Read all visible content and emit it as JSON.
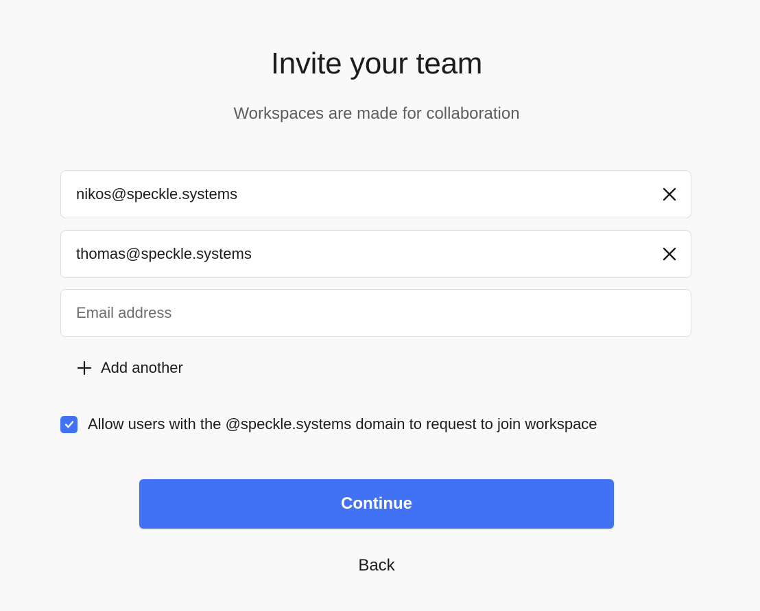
{
  "header": {
    "title": "Invite your team",
    "subtitle": "Workspaces are made for collaboration"
  },
  "invites": [
    {
      "value": "nikos@speckle.systems",
      "remove_icon": "close-icon"
    },
    {
      "value": "thomas@speckle.systems",
      "remove_icon": "close-icon"
    },
    {
      "value": "",
      "placeholder": "Email address"
    }
  ],
  "add_another": {
    "label": "Add another",
    "icon": "plus-icon"
  },
  "domain_option": {
    "checked": true,
    "label": "Allow users with the @speckle.systems domain to request to join workspace",
    "icon": "check-icon"
  },
  "actions": {
    "continue_label": "Continue",
    "back_label": "Back"
  },
  "colors": {
    "accent": "#4272f4",
    "background": "#f9f9f9"
  }
}
